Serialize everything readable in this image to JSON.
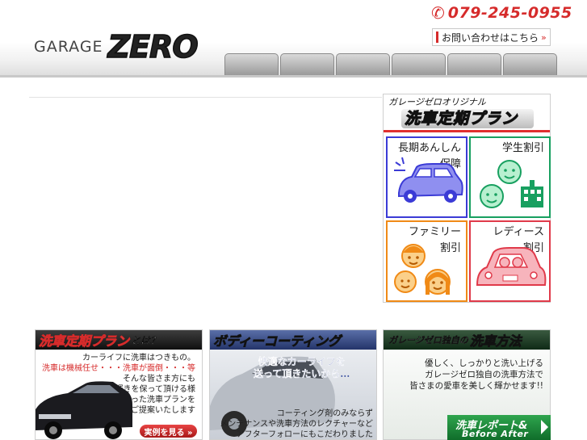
{
  "header": {
    "logo_garage": "GARAGE",
    "logo_zero": "ZERO",
    "phone": "079-245-0955",
    "contact_label": "お問い合わせはこちら",
    "contact_arrow": "»",
    "nav_tab_count": 6
  },
  "plan_panel": {
    "subtitle": "ガレージゼロオリジナル",
    "title": "洗車定期プラン",
    "tiles": [
      {
        "line1": "長期あんしん",
        "line2": "保障",
        "color": "#3b3bd6",
        "icon": "car-icon"
      },
      {
        "line1": "学生割引",
        "line2": "",
        "color": "#18a060",
        "icon": "students-icon"
      },
      {
        "line1": "ファミリー",
        "line2": "割引",
        "color": "#f08a16",
        "icon": "family-icon"
      },
      {
        "line1": "レディース",
        "line2": "割引",
        "color": "#e03a4a",
        "icon": "ladies-car-icon"
      }
    ]
  },
  "banners": {
    "plan": {
      "title": "洗車定期プラン",
      "suffix": "とは？",
      "line1": "カーライフに洗車はつきもの。",
      "line2": "洗車は機械任せ・・・洗車が面倒・・・等",
      "line3": "そんな皆さま方にも",
      "line4": "愛車の輝きを保って頂ける様",
      "line5": "一人ひとりに合った洗車プランを",
      "line6": "ご提案いたします",
      "button": "実例を見る »"
    },
    "coating": {
      "title": "ボディーコーティング",
      "catch1": "快適なカーライフを",
      "catch2": "送って頂きたいから…",
      "line1": "コーティング剤のみならず",
      "line2": "メンテナンスや洗車方法のレクチャーなど",
      "line3": "アフターフォローにもこだわりました"
    },
    "method": {
      "small": "ガレージゼロ独自の",
      "title": "洗車方法",
      "line1": "優しく、しっかりと洗い上げる",
      "line2": "ガレージゼロ独自の洗車方法で",
      "line3": "皆さまの愛車を美しく輝かせます!!",
      "button_l1": "洗車レポート&",
      "button_l2": "Before After"
    }
  }
}
